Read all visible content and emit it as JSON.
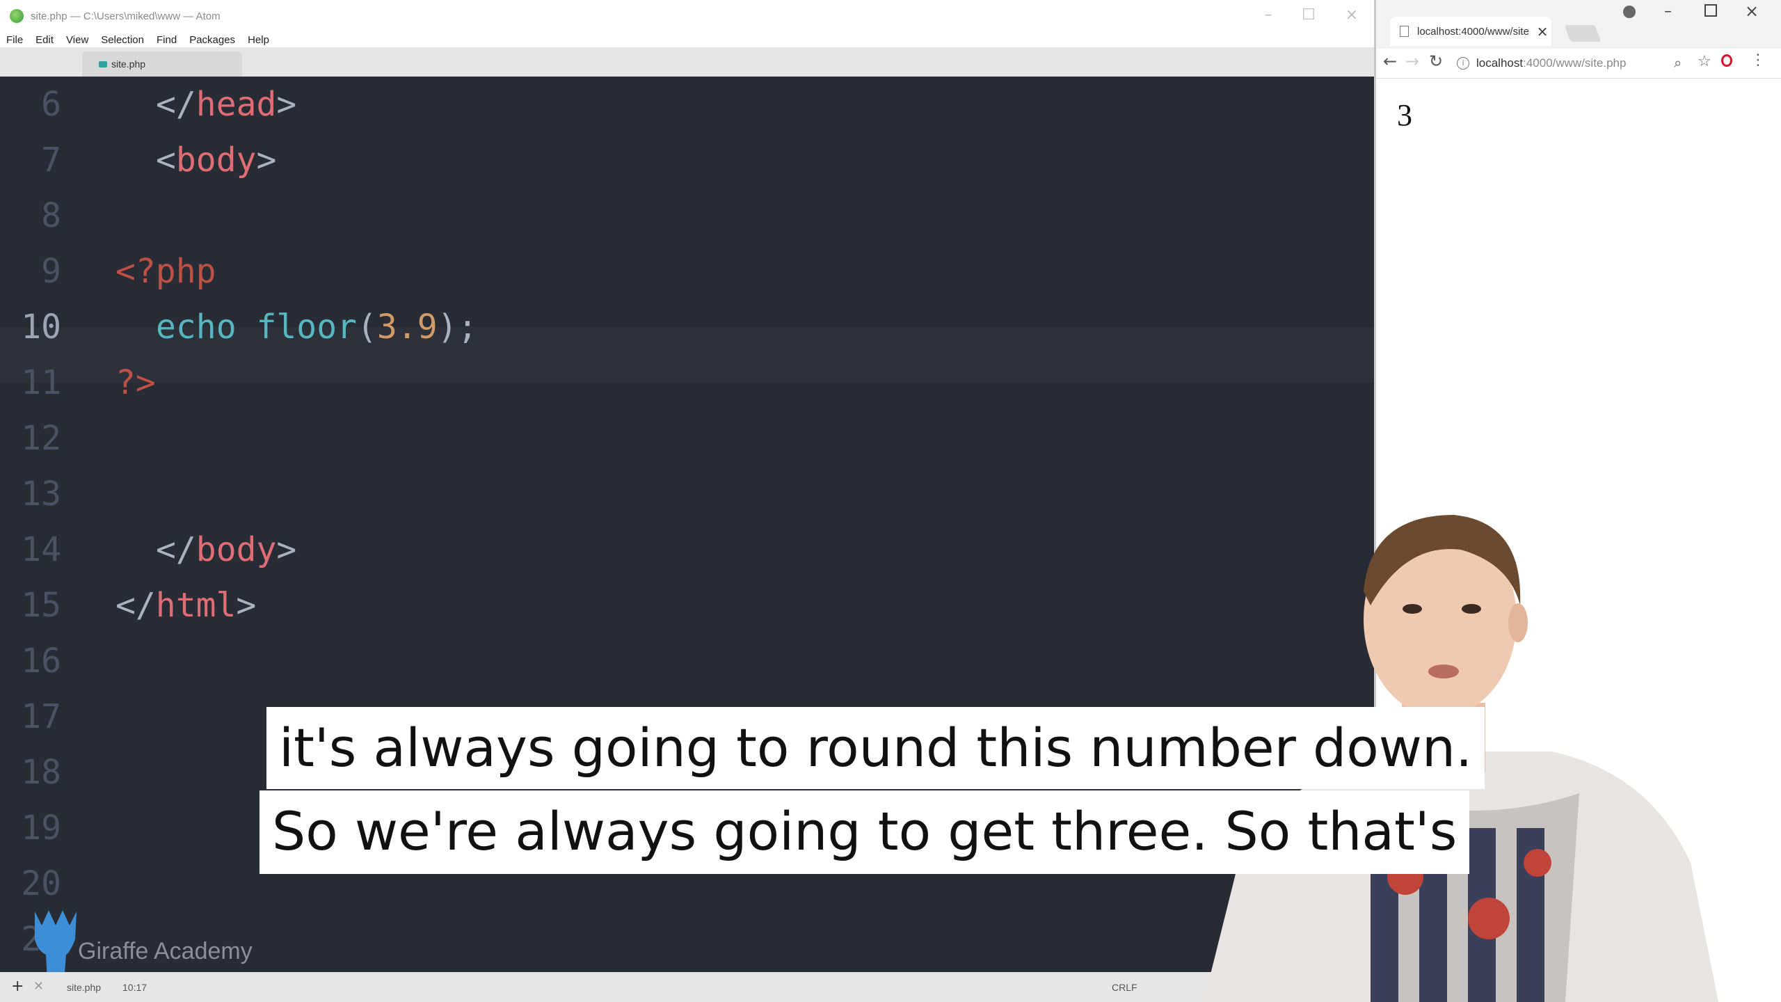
{
  "atom": {
    "title": "site.php — C:\\Users\\miked\\www — Atom",
    "menu": [
      "File",
      "Edit",
      "View",
      "Selection",
      "Find",
      "Packages",
      "Help"
    ],
    "tab_label": "site.php",
    "line_numbers": [
      "6",
      "7",
      "8",
      "9",
      "10",
      "11",
      "12",
      "13",
      "14",
      "15",
      "16",
      "17",
      "18",
      "19",
      "20",
      "21"
    ],
    "active_line": "10",
    "code": {
      "l6": [
        "</",
        "head",
        ">"
      ],
      "l7": [
        "<",
        "body",
        ">"
      ],
      "l9": [
        "<?php"
      ],
      "l10": [
        "echo",
        " ",
        "floor",
        "(",
        "3.9",
        ");"
      ],
      "l11": [
        "?>"
      ],
      "l13": [
        "</",
        "body",
        ">"
      ],
      "l14": [
        "</",
        "html",
        ">"
      ]
    },
    "status": {
      "file": "site.php",
      "position": "10:17",
      "line_ending": "CRLF"
    },
    "watermark": "Giraffe Academy"
  },
  "browser": {
    "tab_title": "localhost:4000/www/site",
    "url_host": "localhost",
    "url_path": ":4000/www/site.php",
    "page_output": "3"
  },
  "captions": {
    "line1": "it's always going to round this number down.",
    "line2": "So we're always going to get three. So that's"
  },
  "colors": {
    "editor_bg": "#282c34",
    "tag": "#e06c75",
    "function": "#61afef",
    "keyword": "#56b6c2",
    "number": "#d19a66"
  }
}
